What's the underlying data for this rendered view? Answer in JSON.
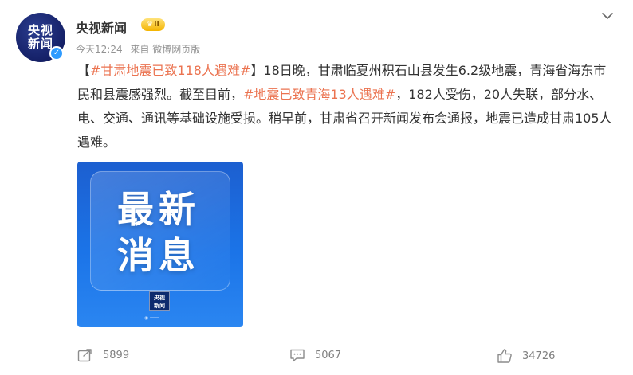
{
  "post": {
    "author": {
      "name": "央视新闻",
      "avatar_line1": "央视",
      "avatar_line2": "新闻",
      "level": "II"
    },
    "time": "今天12:24",
    "source": "来自 微博网页版",
    "text": {
      "bracket_open": "【",
      "topic1": "#甘肃地震已致118人遇难#",
      "bracket_close": "】",
      "part1": "18日晚，甘肃临夏州积石山县发生6.2级地震，青海省海东市民和县震感强烈。截至目前，",
      "topic2": "#地震已致青海13人遇难#",
      "part2": "，182人受伤，20人失联，部分水、电、交通、通讯等基础设施受损。稍早前，甘肃省召开新闻发布会通报，地震已造成甘肃105人遇难。"
    },
    "image": {
      "line1": "最新",
      "line2": "消息",
      "logo_line1": "央视",
      "logo_line2": "新闻"
    },
    "stats": {
      "shares": "5899",
      "comments": "5067",
      "likes": "34726"
    }
  },
  "colors": {
    "topic": "#eb7350",
    "meta": "#939393",
    "image_blue": "#1b74e8"
  },
  "icons": {
    "share": "share-icon",
    "comment": "comment-icon",
    "like": "thumbs-up-icon",
    "more": "chevron-down-icon",
    "verified": "verified-badge-icon"
  }
}
